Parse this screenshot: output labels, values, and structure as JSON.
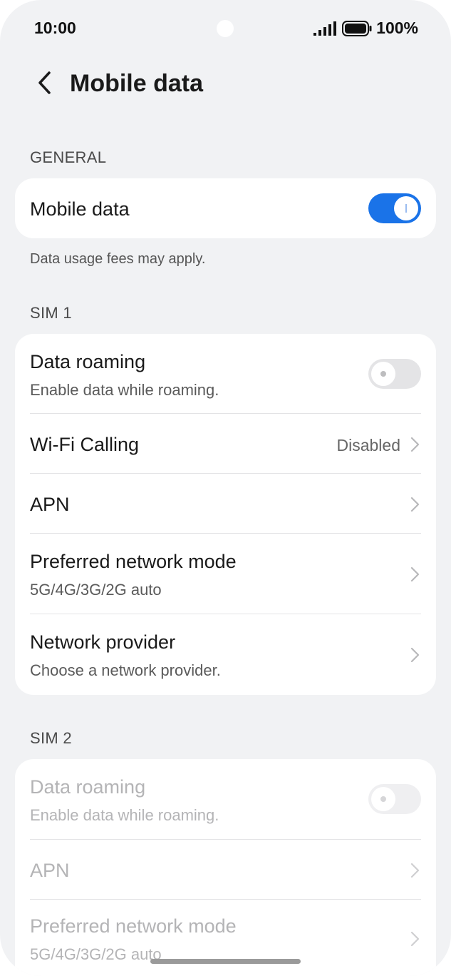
{
  "status_bar": {
    "time": "10:00",
    "battery": "100%",
    "icons": [
      "signal-icon",
      "battery-icon"
    ]
  },
  "header": {
    "back_icon": "chevron-left-icon",
    "title": "Mobile data"
  },
  "general": {
    "section_label": "GENERAL",
    "mobile_data": {
      "label": "Mobile data",
      "enabled": true
    },
    "note": "Data usage fees may apply."
  },
  "sim1": {
    "section_label": "SIM 1",
    "data_roaming": {
      "label": "Data roaming",
      "subtitle": "Enable data while roaming.",
      "enabled": false
    },
    "wifi_calling": {
      "label": "Wi-Fi Calling",
      "value": "Disabled"
    },
    "apn": {
      "label": "APN"
    },
    "preferred_network_mode": {
      "label": "Preferred network mode",
      "subtitle": "5G/4G/3G/2G auto"
    },
    "network_provider": {
      "label": "Network provider",
      "subtitle": "Choose a network provider."
    }
  },
  "sim2": {
    "section_label": "SIM 2",
    "data_roaming": {
      "label": "Data roaming",
      "subtitle": "Enable data while roaming.",
      "enabled": false
    },
    "apn": {
      "label": "APN"
    },
    "preferred_network_mode": {
      "label": "Preferred network mode",
      "subtitle": "5G/4G/3G/2G auto"
    }
  },
  "colors": {
    "accent": "#1a73e8",
    "background": "#f1f2f4",
    "card": "#ffffff",
    "disabled_text": "#b4b4b6"
  }
}
